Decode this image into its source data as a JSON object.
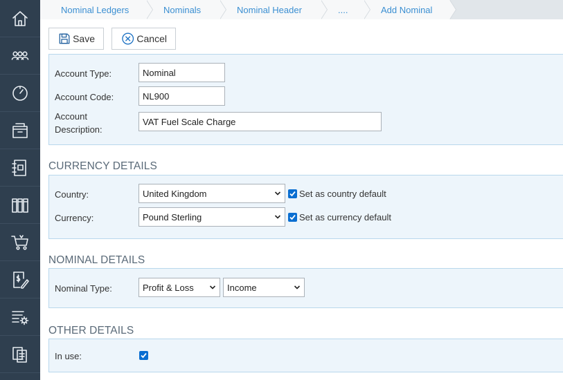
{
  "sidebar": {
    "items": [
      {
        "name": "home-icon"
      },
      {
        "name": "users-icon"
      },
      {
        "name": "dashboard-icon"
      },
      {
        "name": "archive-icon"
      },
      {
        "name": "contacts-book-icon"
      },
      {
        "name": "books-icon"
      },
      {
        "name": "cart-icon"
      },
      {
        "name": "invoice-edit-icon"
      },
      {
        "name": "settings-list-icon"
      },
      {
        "name": "documents-icon"
      }
    ]
  },
  "breadcrumb": {
    "items": [
      "Nominal Ledgers",
      "Nominals",
      "Nominal Header",
      "....",
      "Add Nominal"
    ]
  },
  "toolbar": {
    "save_label": "Save",
    "cancel_label": "Cancel"
  },
  "account": {
    "type_label": "Account Type:",
    "type_value": "Nominal",
    "code_label": "Account Code:",
    "code_value": "NL900",
    "desc_label_line1": "Account",
    "desc_label_line2": "Description:",
    "desc_value": "VAT Fuel Scale Charge"
  },
  "currency_details": {
    "title": "CURRENCY DETAILS",
    "country_label": "Country:",
    "country_value": "United Kingdom",
    "country_default_label": "Set as country default",
    "country_default_checked": true,
    "currency_label": "Currency:",
    "currency_value": "Pound Sterling",
    "currency_default_label": "Set as currency default",
    "currency_default_checked": true
  },
  "nominal_details": {
    "title": "NOMINAL DETAILS",
    "type_label": "Nominal Type:",
    "type_value": "Profit & Loss",
    "subtype_value": "Income"
  },
  "other_details": {
    "title": "OTHER DETAILS",
    "in_use_label": "In use:",
    "in_use_checked": true
  },
  "colors": {
    "sidebar_bg": "#2f3f4f",
    "panel_bg": "#edf5fb",
    "panel_border": "#b8d7ec",
    "link": "#3b8fd2",
    "checkbox": "#0a6ed1"
  }
}
